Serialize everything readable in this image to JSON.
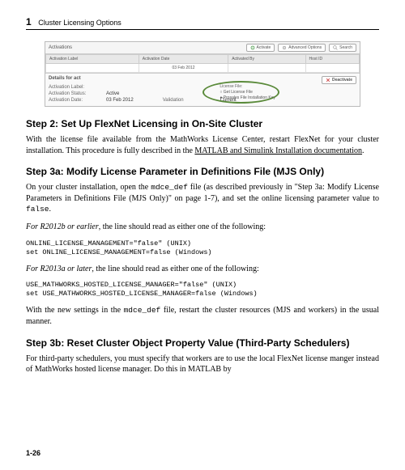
{
  "page": {
    "chapter_num": "1",
    "chapter_title": "Cluster Licensing Options",
    "page_number": "1-26"
  },
  "screenshot": {
    "panel_title": "Activations",
    "buttons": {
      "activate": "Activate",
      "advanced": "Advanced Options",
      "search": "Search"
    },
    "headers": {
      "label": "Activation Label",
      "date": "Activation Date",
      "by": "Activated By",
      "host": "Host ID"
    },
    "row": {
      "label": "",
      "date": "03 Feb 2012",
      "by": "",
      "host": ""
    },
    "details_title": "Details for act",
    "deactivate": "Deactivate",
    "rows": {
      "label_k": "Activation Label:",
      "label_v": "",
      "status_k": "Activation Status:",
      "status_v": "Active",
      "date_k": "Activation Date:",
      "date_v": "03 Feb 2012",
      "license_k": "License File:",
      "radio1": "Get License File",
      "radio2": "Prosales File Installation Key",
      "validation_k": "Validation",
      "validation_v": "Current"
    }
  },
  "step2": {
    "heading": "Step 2: Set Up FlexNet Licensing in On-Site Cluster",
    "p1a": "With the license file available from the MathWorks License Center, restart FlexNet for your cluster installation. This procedure is fully described in the ",
    "p1_link": "MATLAB and Simulink Installation documentation",
    "p1b": "."
  },
  "step3a": {
    "heading": "Step 3a: Modify License Parameter in Definitions File (MJS Only)",
    "p1a": "On your cluster installation, open the ",
    "p1_code": "mdce_def",
    "p1b": " file (as described previously in \"Step 3a: Modify License Parameters in Definitions File (MJS Only)\" on page 1-7), and set the online licensing parameter value to ",
    "p1_code2": "false",
    "p1c": ".",
    "p2_em": "For R2012b or earlier",
    "p2_rest": ", the line should read as either one of the following:",
    "code1": "ONLINE_LICENSE_MANAGEMENT=\"false\" (UNIX)\nset ONLINE_LICENSE_MANAGEMENT=false (Windows)",
    "p3_em": "For R2013a or later",
    "p3_rest": ", the line should read as either one of the following:",
    "code2": "USE_MATHWORKS_HOSTED_LICENSE_MANAGER=\"false\" (UNIX)\nset USE_MATHWORKS_HOSTED_LICENSE_MANAGER=false (Windows)",
    "p4a": "With the new settings in the ",
    "p4_code": "mdce_def",
    "p4b": " file, restart the cluster resources (MJS and workers) in the usual manner."
  },
  "step3b": {
    "heading": "Step 3b: Reset Cluster Object Property Value (Third-Party Schedulers)",
    "p1": "For third-party schedulers, you must specify that workers are to use the local FlexNet license manger instead of MathWorks hosted license manager. Do this in MATLAB by"
  }
}
